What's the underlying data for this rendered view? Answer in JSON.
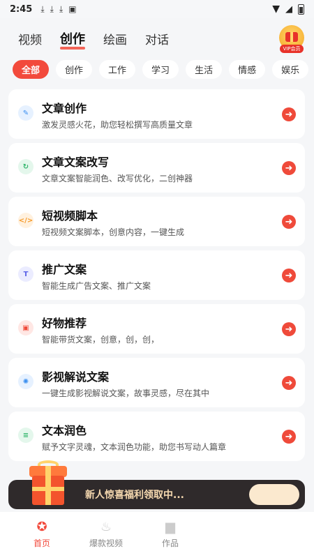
{
  "status_bar": {
    "time": "2:45"
  },
  "top_tabs": [
    {
      "label": "视频",
      "active": false
    },
    {
      "label": "创作",
      "active": true
    },
    {
      "label": "绘画",
      "active": false
    },
    {
      "label": "对话",
      "active": false
    }
  ],
  "vip": {
    "label": "VIP会员"
  },
  "chips": [
    {
      "label": "全部",
      "active": true
    },
    {
      "label": "创作",
      "active": false
    },
    {
      "label": "工作",
      "active": false
    },
    {
      "label": "学习",
      "active": false
    },
    {
      "label": "生活",
      "active": false
    },
    {
      "label": "情感",
      "active": false
    },
    {
      "label": "娱乐",
      "active": false
    }
  ],
  "cards": [
    {
      "title": "文章创作",
      "desc": "激发灵感火花，助您轻松撰写高质量文章",
      "icon": "pen-icon",
      "icon_glyph": "✎",
      "icon_color": "#3a8ff0",
      "icon_bg": "#e6f1ff"
    },
    {
      "title": "文章文案改写",
      "desc": "文章文案智能润色、改写优化，二创神器",
      "icon": "rewrite-icon",
      "icon_glyph": "↻",
      "icon_color": "#2fb56a",
      "icon_bg": "#e4f7ec"
    },
    {
      "title": "短视频脚本",
      "desc": "短视频文案脚本，创意内容，一键生成",
      "icon": "script-icon",
      "icon_glyph": "</>",
      "icon_color": "#f59a2a",
      "icon_bg": "#fff1df"
    },
    {
      "title": "推广文案",
      "desc": "智能生成广告文案、推广文案",
      "icon": "text-icon",
      "icon_glyph": "T",
      "icon_color": "#5b63e8",
      "icon_bg": "#ebecff"
    },
    {
      "title": "好物推荐",
      "desc": "智能带货文案，创意，创，创，",
      "icon": "bag-icon",
      "icon_glyph": "▣",
      "icon_color": "#ef4a3a",
      "icon_bg": "#ffe7e4"
    },
    {
      "title": "影视解说文案",
      "desc": "一键生成影视解说文案，故事灵感，尽在其中",
      "icon": "film-icon",
      "icon_glyph": "✺",
      "icon_color": "#3a8ff0",
      "icon_bg": "#e6f1ff"
    },
    {
      "title": "文本润色",
      "desc": "赋予文字灵魂，文本润色功能，助您书写动人篇章",
      "icon": "document-icon",
      "icon_glyph": "≡",
      "icon_color": "#2fb56a",
      "icon_bg": "#e4f7ec"
    }
  ],
  "promo": {
    "text": "新人惊喜福利领取中..."
  },
  "bottom_nav": [
    {
      "label": "首页",
      "icon": "home-icon",
      "glyph": "✪",
      "active": true
    },
    {
      "label": "爆款视频",
      "icon": "fire-icon",
      "glyph": "♨",
      "active": false
    },
    {
      "label": "作品",
      "icon": "folder-icon",
      "glyph": "▆",
      "active": false
    }
  ]
}
